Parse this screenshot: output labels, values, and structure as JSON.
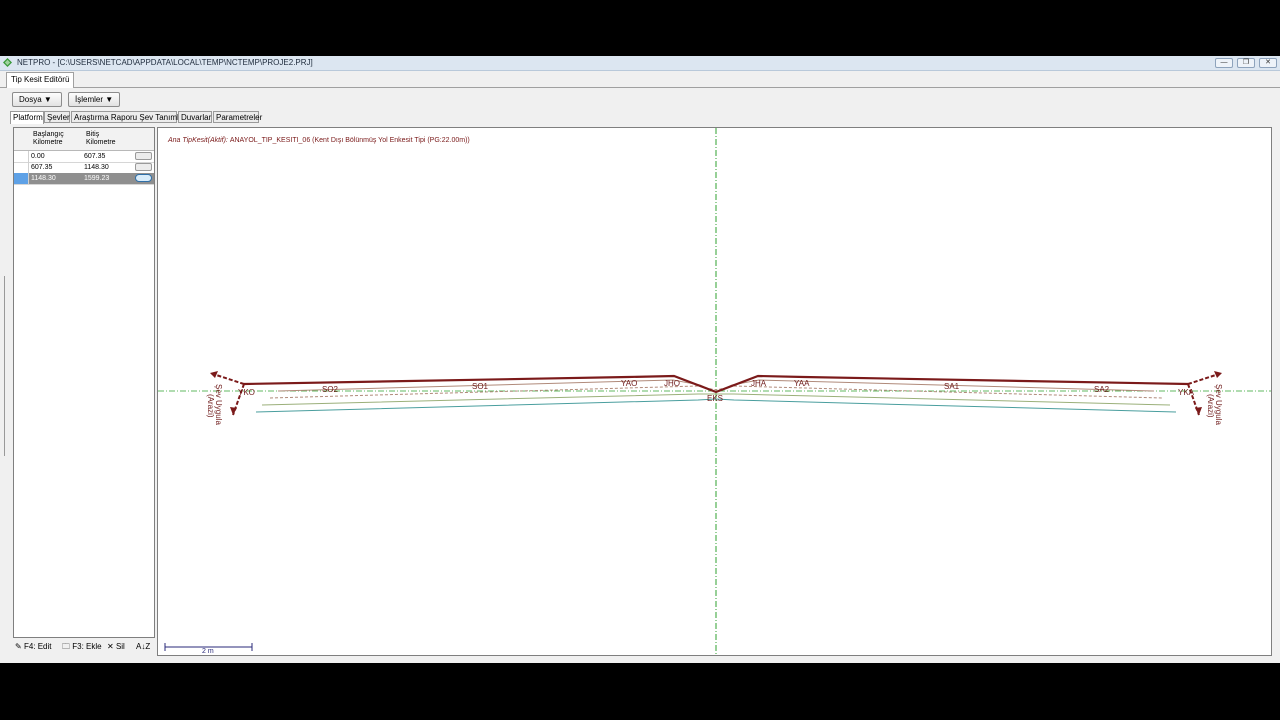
{
  "window": {
    "title": "NETPRO - [C:\\USERS\\NETCAD\\APPDATA\\LOCAL\\TEMP\\NCTEMP\\PROJE2.PRJ]",
    "doc_tab": "Tip Kesit Editörü",
    "minimize": "—",
    "restore": "❐",
    "close": "✕"
  },
  "toolbar": {
    "dosya": "Dosya ▼",
    "islemler": "İşlemler ▼"
  },
  "tabs": [
    "Platform",
    "Şevler",
    "Araştırma Raporu Şev Tanımları",
    "Duvarlar",
    "Parametreler"
  ],
  "grid": {
    "col1": [
      "Başlangıç",
      "Kilometre"
    ],
    "col2": [
      "Bitiş",
      "Kilometre"
    ],
    "rows": [
      {
        "start": "0.00",
        "end": "607.35"
      },
      {
        "start": "607.35",
        "end": "1148.30"
      },
      {
        "start": "1148.30",
        "end": "1599.23"
      }
    ]
  },
  "bottom_tools": {
    "edit": "F4: Edit",
    "add": "F3: Ekle",
    "delete": "Sil",
    "sort": "A↓Z"
  },
  "section": {
    "title_prefix": "Ana TipKesit(Aktif):",
    "title_value": "ANAYOL_TIP_KESITI_06 (Kent Dışı Bölünmüş Yol Enkesit Tipi (PG:22.00m))",
    "labels": {
      "yko": "YKO",
      "so2": "SO2",
      "so1": "SO1",
      "yao": "YAO",
      "jho": "JHO",
      "eks": "EKS",
      "jha": "JHA",
      "yaa": "YAA",
      "sa1": "SA1",
      "sa2": "SA2",
      "yka": "YKA"
    },
    "slope_left": [
      "Şev Uygula",
      "(Arazi)"
    ],
    "slope_right": [
      "Şev Uygula",
      "(Arazi)"
    ],
    "scale": "2 m"
  },
  "colors": {
    "surface": "#7b1a1a",
    "layer1": "#b08a7a",
    "layer2": "#9bb07a",
    "layer3": "#4a9e9e",
    "axis": "#2fa12f"
  }
}
